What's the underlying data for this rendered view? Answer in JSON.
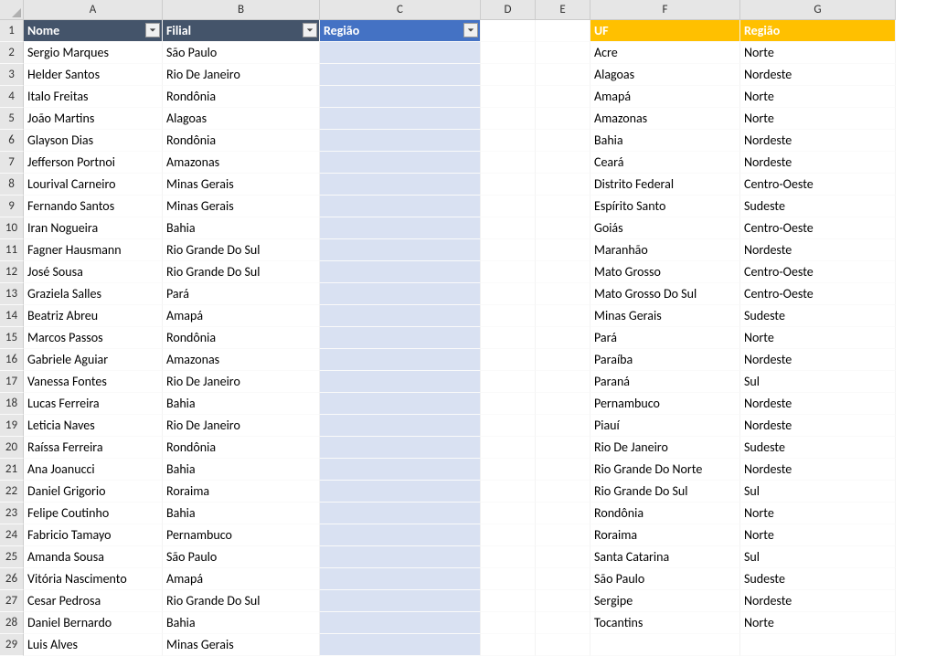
{
  "columns": [
    "A",
    "B",
    "C",
    "D",
    "E",
    "F",
    "G"
  ],
  "table1": {
    "headers": {
      "A": "Nome",
      "B": "Filial",
      "C": "Região"
    },
    "rows": [
      {
        "A": "Sergio Marques",
        "B": "São Paulo",
        "C": ""
      },
      {
        "A": "Helder Santos",
        "B": "Rio De Janeiro",
        "C": ""
      },
      {
        "A": "Italo Freitas",
        "B": "Rondônia",
        "C": ""
      },
      {
        "A": "João Martins",
        "B": "Alagoas",
        "C": ""
      },
      {
        "A": "Glayson Dias",
        "B": "Rondônia",
        "C": ""
      },
      {
        "A": "Jefferson Portnoi",
        "B": "Amazonas",
        "C": ""
      },
      {
        "A": "Lourival Carneiro",
        "B": "Minas Gerais",
        "C": ""
      },
      {
        "A": "Fernando Santos",
        "B": "Minas Gerais",
        "C": ""
      },
      {
        "A": "Iran Nogueira",
        "B": "Bahia",
        "C": ""
      },
      {
        "A": "Fagner Hausmann",
        "B": "Rio Grande Do Sul",
        "C": ""
      },
      {
        "A": "José Sousa",
        "B": "Rio Grande Do Sul",
        "C": ""
      },
      {
        "A": "Graziela Salles",
        "B": "Pará",
        "C": ""
      },
      {
        "A": "Beatriz Abreu",
        "B": "Amapá",
        "C": ""
      },
      {
        "A": "Marcos Passos",
        "B": "Rondônia",
        "C": ""
      },
      {
        "A": "Gabriele Aguiar",
        "B": "Amazonas",
        "C": ""
      },
      {
        "A": "Vanessa Fontes",
        "B": "Rio De Janeiro",
        "C": ""
      },
      {
        "A": "Lucas Ferreira",
        "B": "Bahia",
        "C": ""
      },
      {
        "A": "Leticia Naves",
        "B": "Rio De Janeiro",
        "C": ""
      },
      {
        "A": "Raíssa Ferreira",
        "B": "Rondônia",
        "C": ""
      },
      {
        "A": "Ana Joanucci",
        "B": "Bahia",
        "C": ""
      },
      {
        "A": "Daniel Grigorio",
        "B": "Roraima",
        "C": ""
      },
      {
        "A": "Felipe Coutinho",
        "B": "Bahia",
        "C": ""
      },
      {
        "A": "Fabricio Tamayo",
        "B": "Pernambuco",
        "C": ""
      },
      {
        "A": "Amanda Sousa",
        "B": "São Paulo",
        "C": ""
      },
      {
        "A": "Vitória Nascimento",
        "B": "Amapá",
        "C": ""
      },
      {
        "A": "Cesar Pedrosa",
        "B": "Rio Grande Do Sul",
        "C": ""
      },
      {
        "A": "Daniel Bernardo",
        "B": "Bahia",
        "C": ""
      },
      {
        "A": "Luis Alves",
        "B": "Minas Gerais",
        "C": ""
      }
    ]
  },
  "table2": {
    "headers": {
      "F": "UF",
      "G": "Região"
    },
    "rows": [
      {
        "F": "Acre",
        "G": "Norte"
      },
      {
        "F": "Alagoas",
        "G": "Nordeste"
      },
      {
        "F": "Amapá",
        "G": "Norte"
      },
      {
        "F": "Amazonas",
        "G": "Norte"
      },
      {
        "F": "Bahia",
        "G": "Nordeste"
      },
      {
        "F": "Ceará",
        "G": "Nordeste"
      },
      {
        "F": "Distrito Federal",
        "G": "Centro-Oeste"
      },
      {
        "F": "Espírito Santo",
        "G": "Sudeste"
      },
      {
        "F": "Goiás",
        "G": "Centro-Oeste"
      },
      {
        "F": "Maranhão",
        "G": "Nordeste"
      },
      {
        "F": "Mato Grosso",
        "G": "Centro-Oeste"
      },
      {
        "F": "Mato Grosso Do Sul",
        "G": "Centro-Oeste"
      },
      {
        "F": "Minas Gerais",
        "G": "Sudeste"
      },
      {
        "F": "Pará",
        "G": "Norte"
      },
      {
        "F": "Paraíba",
        "G": "Nordeste"
      },
      {
        "F": "Paraná",
        "G": "Sul"
      },
      {
        "F": "Pernambuco",
        "G": "Nordeste"
      },
      {
        "F": "Piauí",
        "G": "Nordeste"
      },
      {
        "F": "Rio De Janeiro",
        "G": "Sudeste"
      },
      {
        "F": "Rio Grande Do Norte",
        "G": "Nordeste"
      },
      {
        "F": "Rio Grande Do Sul",
        "G": "Sul"
      },
      {
        "F": "Rondônia",
        "G": "Norte"
      },
      {
        "F": "Roraima",
        "G": "Norte"
      },
      {
        "F": "Santa Catarina",
        "G": "Sul"
      },
      {
        "F": "São Paulo",
        "G": "Sudeste"
      },
      {
        "F": "Sergipe",
        "G": "Nordeste"
      },
      {
        "F": "Tocantins",
        "G": "Norte"
      }
    ]
  }
}
